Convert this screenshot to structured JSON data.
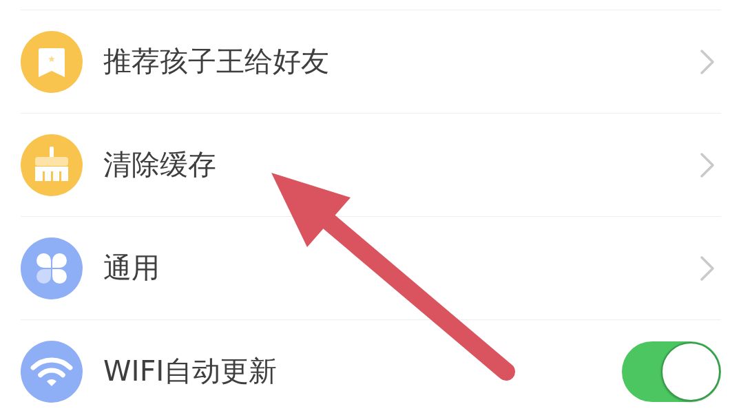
{
  "settings": [
    {
      "label": "推荐孩子王给好友",
      "kind": "link"
    },
    {
      "label": "清除缓存",
      "kind": "link"
    },
    {
      "label": "通用",
      "kind": "link"
    },
    {
      "label": "WIFI自动更新",
      "kind": "toggle",
      "on": true
    }
  ]
}
